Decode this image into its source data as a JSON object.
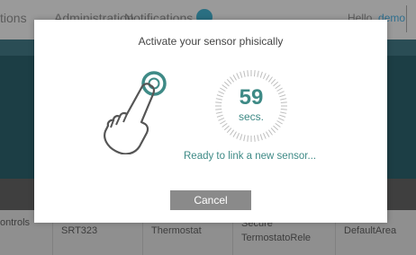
{
  "nav": {
    "partial_item": "tions",
    "administration": "Administration",
    "notifications": "Notifications",
    "hello_prefix": "Hello,",
    "username": "demo"
  },
  "table_row": {
    "col1": "ontrols",
    "col2": "SRT323",
    "col3": "Thermostat",
    "col4_line1": "Secure",
    "col4_line2": "TermostatoRele",
    "col5": "DefaultArea"
  },
  "modal": {
    "title": "Activate your sensor phisically",
    "timer_value": "59",
    "timer_unit": "secs.",
    "status": "Ready to link a new sensor...",
    "cancel_label": "Cancel",
    "icons": [
      "hand-pointer-icon",
      "countdown-timer-icon"
    ]
  },
  "colors": {
    "accent": "#3e8a86",
    "cancel_button": "#8a8a8a",
    "overlay": "#8e8e8e"
  }
}
